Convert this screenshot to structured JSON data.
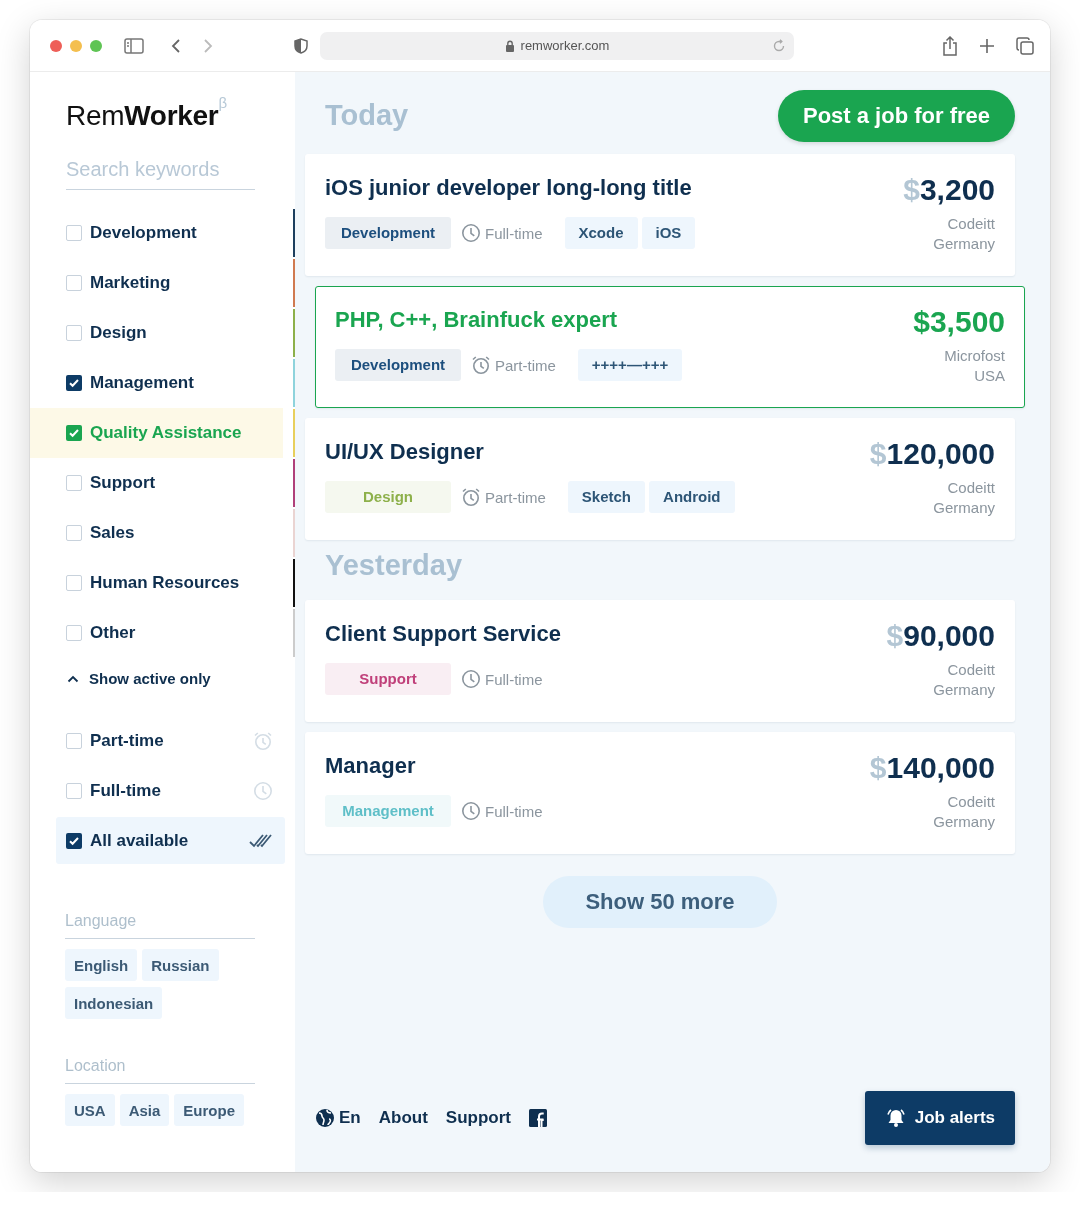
{
  "browser": {
    "url": "remworker.com"
  },
  "logo": "Rem**Worker**$^{β}$",
  "search": {
    "placeholder": "Search keywords"
  },
  "categories": [
    {
      "label": "Development",
      "checked": false,
      "selected": false,
      "color": "#1d3f5e"
    },
    {
      "label": "Marketing",
      "checked": false,
      "selected": false,
      "color": "#d07a50"
    },
    {
      "label": "Design",
      "checked": false,
      "selected": false,
      "color": "#8db04a"
    },
    {
      "label": "Management",
      "checked": true,
      "selected": false,
      "color": "#8ed3dc"
    },
    {
      "label": "Quality Assistance",
      "checked": true,
      "selected": true,
      "color": "#e8cf5c"
    },
    {
      "label": "Support",
      "checked": false,
      "selected": false,
      "color": "#b0407a"
    },
    {
      "label": "Sales",
      "checked": false,
      "selected": false,
      "color": "#ead4d2"
    },
    {
      "label": "Human Resources",
      "checked": false,
      "selected": false,
      "color": "#111111"
    },
    {
      "label": "Other",
      "checked": false,
      "selected": false,
      "color": "#cccccc"
    }
  ],
  "show_active_toggle": {
    "label": "Show active only",
    "expanded": true
  },
  "job_types": [
    {
      "label": "Part-time",
      "kind": "alarm",
      "checked": false,
      "selected": false
    },
    {
      "label": "Full-time",
      "kind": "clock",
      "checked": false,
      "selected": false
    },
    {
      "label": "All available",
      "kind": "all",
      "checked": true,
      "selected": true
    }
  ],
  "language": {
    "title": "Language",
    "options": [
      "English",
      "Russian",
      "Indonesian"
    ]
  },
  "location": {
    "title": "Location",
    "options": [
      "USA",
      "Asia",
      "Europe"
    ]
  },
  "post_button": "Post a job for free",
  "sections": [
    {
      "title": "Today",
      "jobs": [
        {
          "title": "iOS junior developer long-long title",
          "highlighted": false,
          "salary": "$3,200",
          "company": "Codeitt",
          "country": "Germany",
          "category": {
            "label": "Development",
            "color": "#1d4f7e"
          },
          "schedule": {
            "label": "Full-time",
            "kind": "clock"
          },
          "skills": [
            "Xcode",
            "iOS"
          ]
        },
        {
          "title": "PHP, C++, Brainfuck expert",
          "highlighted": true,
          "salary": "$3,500",
          "company": "Microfost",
          "country": "USA",
          "category": {
            "label": "Development",
            "color": "#1d4f7e"
          },
          "schedule": {
            "label": "Part-time",
            "kind": "alarm"
          },
          "skills": [
            "++++—+++"
          ]
        },
        {
          "title": "UI/UX Designer",
          "highlighted": false,
          "salary": "$120,000",
          "company": "Codeitt",
          "country": "Germany",
          "category": {
            "label": "Design",
            "color": "#8db04a"
          },
          "schedule": {
            "label": "Part-time",
            "kind": "alarm"
          },
          "skills": [
            "Sketch",
            "Android"
          ]
        }
      ]
    },
    {
      "title": "Yesterday",
      "jobs": [
        {
          "title": "Client Support Service",
          "highlighted": false,
          "salary": "$90,000",
          "company": "Codeitt",
          "country": "Germany",
          "category": {
            "label": "Support",
            "color": "#c0407a"
          },
          "schedule": {
            "label": "Full-time",
            "kind": "clock"
          }
        },
        {
          "title": "Manager",
          "highlighted": false,
          "salary": "$140,000",
          "company": "Codeitt",
          "country": "Germany",
          "category": {
            "label": "Management",
            "color": "#5fbfc8"
          },
          "schedule": {
            "label": "Full-time",
            "kind": "clock"
          }
        }
      ]
    }
  ],
  "show_more": "Show 50 more",
  "footer": {
    "language": "En",
    "links": [
      "About",
      "Support"
    ]
  },
  "job_alerts": "Job alerts"
}
